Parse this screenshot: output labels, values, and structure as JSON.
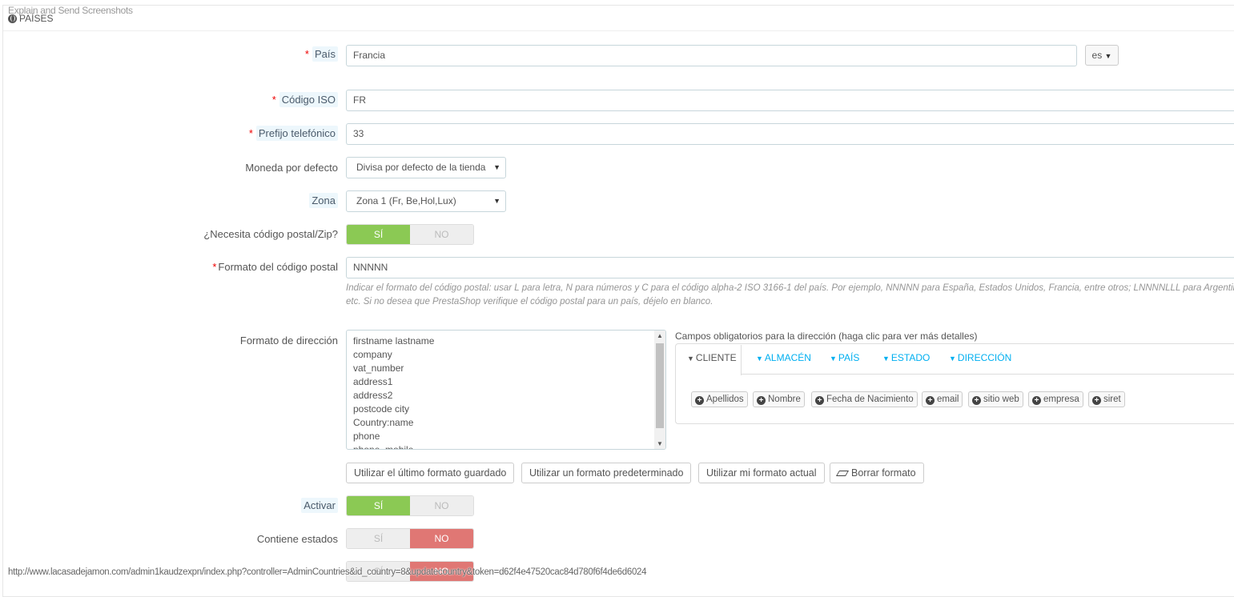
{
  "overlay_tip": "Explain and Send Screenshots",
  "panel": {
    "heading": "PAÍSES"
  },
  "fields": {
    "country": {
      "label": "País",
      "value": "Francia",
      "lang": "es"
    },
    "iso": {
      "label": "Código ISO",
      "value": "FR"
    },
    "phone_prefix": {
      "label": "Prefijo telefónico",
      "value": "33"
    },
    "currency": {
      "label": "Moneda por defecto",
      "value": "Divisa por defecto de la tienda"
    },
    "zone": {
      "label": "Zona",
      "value": "Zona 1 (Fr, Be,Hol,Lux)"
    },
    "needs_zip": {
      "label": "¿Necesita código postal/Zip?",
      "yes": "SÍ",
      "no": "NO",
      "selected": "yes"
    },
    "zip_format": {
      "label": "Formato del código postal",
      "value": "NNNNN",
      "help_line1": "Indicar el formato del código postal: usar L para letra, N para números y C para el código alpha-2 ISO 3166-1 del país. Por ejemplo, NNNNN para España, Estados Unidos, Francia, entre otros; LNNNNLLL para Argentina,",
      "help_line2": "etc. Si no desea que PrestaShop verifique el código postal para un país, déjelo en blanco."
    },
    "address_format": {
      "label": "Formato de dirección",
      "lines": [
        "firstname lastname",
        "company",
        "vat_number",
        "address1",
        "address2",
        "postcode city",
        "Country:name",
        "phone",
        "phone_mobile"
      ]
    },
    "active": {
      "label": "Activar",
      "yes": "SÍ",
      "no": "NO",
      "selected": "yes"
    },
    "contains_states": {
      "label": "Contiene estados",
      "yes": "SÍ",
      "no": "NO",
      "selected": "no"
    },
    "row_partial": {
      "yes": "SÍ",
      "no": "NO",
      "selected": "no"
    }
  },
  "required_fields": {
    "title": "Campos obligatorios para la dirección (haga clic para ver más detalles)",
    "tabs": [
      "CLIENTE",
      "ALMACÉN",
      "PAÍS",
      "ESTADO",
      "DIRECCIÓN"
    ],
    "active_tab": "CLIENTE",
    "chips": [
      "Apellidos",
      "Nombre",
      "Fecha de Nacimiento",
      "email",
      "sitio web",
      "empresa",
      "siret"
    ]
  },
  "format_buttons": {
    "last_saved": "Utilizar el último formato guardado",
    "default": "Utilizar un formato predeterminado",
    "current": "Utilizar mi formato actual",
    "clear": "Borrar formato"
  },
  "status_bar": "http://www.lacasadejamon.com/admin1kaudzexpn/index.php?controller=AdminCountries&id_country=8&updatecountry&token=d62f4e47520cac84d780f6f4de6d6024"
}
